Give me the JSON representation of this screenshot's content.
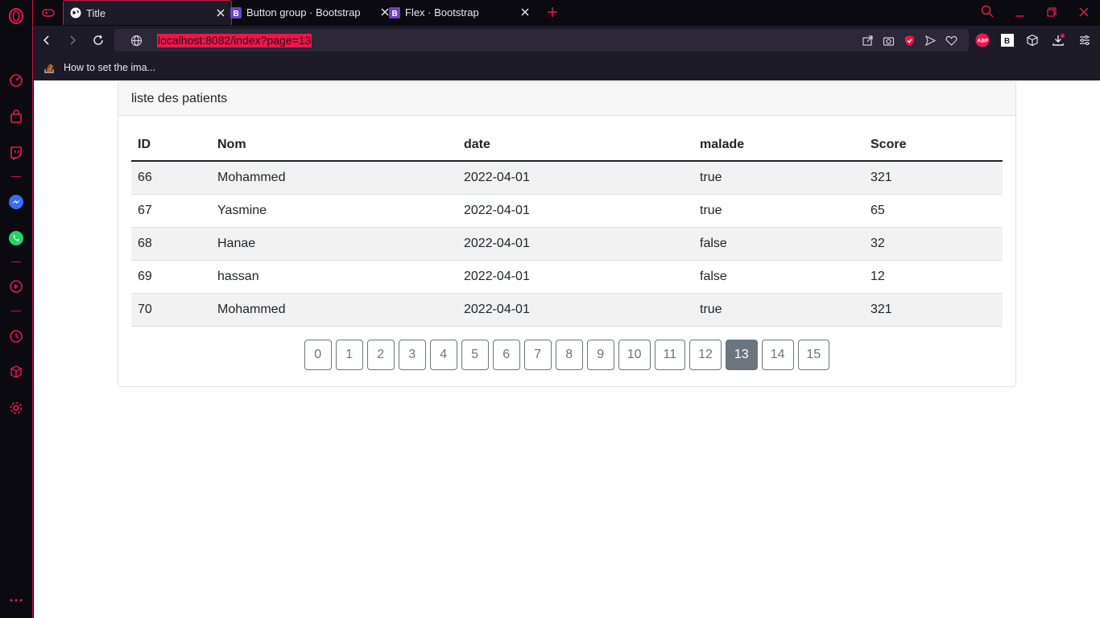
{
  "browser": {
    "tabs": [
      {
        "title": "Title",
        "favicon": "globe-icon",
        "active": true
      },
      {
        "title": "Button group · Bootstrap",
        "favicon": "bootstrap-icon",
        "active": false
      },
      {
        "title": "Flex · Bootstrap",
        "favicon": "bootstrap-icon",
        "active": false
      }
    ],
    "address": "localhost:8082/index?page=13",
    "bookmarks": [
      {
        "label": "How to set the ima..."
      }
    ],
    "accent_color": "#e8194a"
  },
  "card": {
    "header": "liste des patients"
  },
  "table": {
    "columns": [
      "ID",
      "Nom",
      "date",
      "malade",
      "Score"
    ],
    "rows": [
      [
        "66",
        "Mohammed",
        "2022-04-01",
        "true",
        "321"
      ],
      [
        "67",
        "Yasmine",
        "2022-04-01",
        "true",
        "65"
      ],
      [
        "68",
        "Hanae",
        "2022-04-01",
        "false",
        "32"
      ],
      [
        "69",
        "hassan",
        "2022-04-01",
        "false",
        "12"
      ],
      [
        "70",
        "Mohammed",
        "2022-04-01",
        "true",
        "321"
      ]
    ]
  },
  "pagination": {
    "pages": [
      "0",
      "1",
      "2",
      "3",
      "4",
      "5",
      "6",
      "7",
      "8",
      "9",
      "10",
      "11",
      "12",
      "13",
      "14",
      "15"
    ],
    "current": "13"
  }
}
